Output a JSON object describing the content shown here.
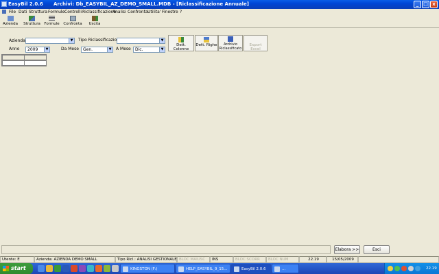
{
  "window": {
    "app_title": "EasyBil  2.0.6",
    "doc_title": "Archivi: Db_EASYBIL_AZ_DEMO_SMALL.MDB - [Riclassificazione Annuale]",
    "minimize_glyph": "_",
    "maximize_glyph": "□",
    "close_glyph": "x"
  },
  "menu": [
    "File",
    "Dati",
    "Struttura",
    "Formule",
    "Controlli",
    "Riclassificazione",
    "Analisi",
    "Confronta",
    "Utilita'",
    "Finestre",
    "?"
  ],
  "toolbar": [
    {
      "label": "Azienda",
      "icon": "building-icon"
    },
    {
      "label": "Struttura",
      "icon": "structure-icon"
    },
    {
      "label": "Formule",
      "icon": "formula-icon"
    },
    {
      "label": "Confronta",
      "icon": "compare-icon"
    },
    {
      "label": "Uscita",
      "icon": "exit-icon"
    }
  ],
  "form": {
    "azienda_label": "Azienda",
    "azienda_value": "",
    "tipo_label": "Tipo Riclassificazione",
    "tipo_value": "",
    "anno_label": "Anno",
    "anno_value": "2009",
    "da_mese_label": "Da Mese",
    "da_mese_value": "Gen.",
    "a_mese_label": "A Mese",
    "a_mese_value": "Dic.",
    "dropdown_glyph": "▼"
  },
  "actions": {
    "dett_colonne": "Dett. Colonne",
    "dett_righe": "Dett. Righe",
    "archivio_line1": "Archivio",
    "archivio_line2": "Riclassificato",
    "export_excel": "Export Excel"
  },
  "bottom_buttons": {
    "elabora": "Elabora >>",
    "esci": "Esci"
  },
  "status": {
    "utente": "Utente: E",
    "azienda": "Azienda: AZIENDA DEMO SMALL",
    "tipo": "Tipo Ricl.: ANALISI GESTIONALE",
    "bloc_maiusc": "BLOC MAIUSC",
    "ins": "INS",
    "bloc_scorr": "BLOC SCORR",
    "bloc_num": "BLOC NUM",
    "time": "22.19",
    "date": "15/05/2009"
  },
  "taskbar": {
    "start": "start",
    "tasks": [
      {
        "label": "KINGSTON (F:)",
        "active": false
      },
      {
        "label": "HELP_EASYBIL_9_15...",
        "active": false
      },
      {
        "label": "EasyBil  2.0.6",
        "active": true
      },
      {
        "label": "...",
        "active": false
      }
    ],
    "clock": "22.19"
  }
}
